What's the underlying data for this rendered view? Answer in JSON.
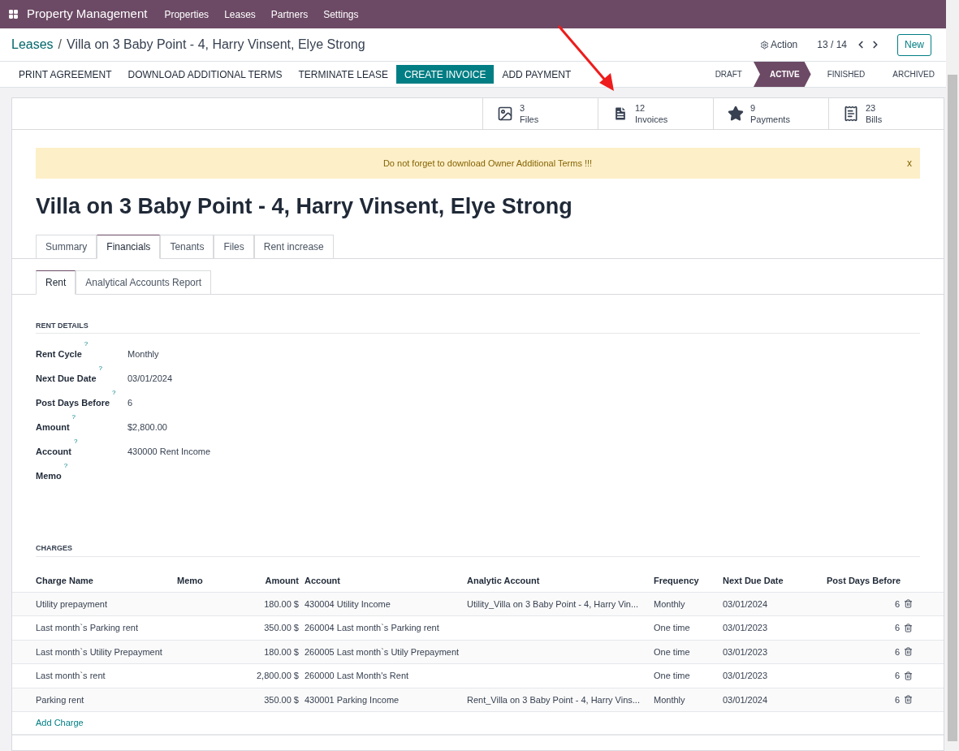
{
  "navbar": {
    "app_name": "Property Management",
    "menu": [
      "Properties",
      "Leases",
      "Partners",
      "Settings"
    ]
  },
  "breadcrumb": {
    "parent": "Leases",
    "separator": "/",
    "current": "Villa on 3 Baby Point - 4, Harry Vinsent, Elye Strong"
  },
  "control_panel": {
    "action": "Action",
    "pager": "13 / 14",
    "new_button": "New"
  },
  "action_buttons": [
    {
      "label": "PRINT AGREEMENT",
      "primary": false
    },
    {
      "label": "DOWNLOAD ADDITIONAL TERMS",
      "primary": false
    },
    {
      "label": "TERMINATE LEASE",
      "primary": false
    },
    {
      "label": "CREATE INVOICE",
      "primary": true
    },
    {
      "label": "ADD PAYMENT",
      "primary": false
    }
  ],
  "status_stages": [
    {
      "label": "DRAFT",
      "selected": false
    },
    {
      "label": "ACTIVE",
      "selected": true
    },
    {
      "label": "FINISHED",
      "selected": false
    },
    {
      "label": "ARCHIVED",
      "selected": false
    }
  ],
  "smart_buttons": [
    {
      "kind": "image",
      "count": "3",
      "label": "Files"
    },
    {
      "kind": "document",
      "count": "12",
      "label": "Invoices"
    },
    {
      "kind": "star",
      "count": "9",
      "label": "Payments"
    },
    {
      "kind": "bill",
      "count": "23",
      "label": "Bills"
    }
  ],
  "alert": {
    "message": "Do not forget to download Owner Additional Terms !!!",
    "close": "x"
  },
  "title": "Villa on 3 Baby Point - 4, Harry Vinsent, Elye Strong",
  "tabs": [
    {
      "label": "Summary",
      "selected": false
    },
    {
      "label": "Financials",
      "selected": true
    },
    {
      "label": "Tenants",
      "selected": false
    },
    {
      "label": "Files",
      "selected": false
    },
    {
      "label": "Rent increase",
      "selected": false
    }
  ],
  "subtabs": [
    {
      "label": "Rent",
      "selected": true
    },
    {
      "label": "Analytical Accounts Report",
      "selected": false
    }
  ],
  "rent_details": {
    "heading": "RENT DETAILS",
    "fields": [
      {
        "label": "Rent Cycle",
        "help": "?",
        "value": "Monthly"
      },
      {
        "label": "Next Due Date",
        "help": "?",
        "value": "03/01/2024"
      },
      {
        "label": "Post Days Before",
        "help": "?",
        "value": "6"
      },
      {
        "label": "Amount",
        "help": "?",
        "value": "$2,800.00"
      },
      {
        "label": "Account",
        "help": "?",
        "value": "430000 Rent Income"
      },
      {
        "label": "Memo",
        "help": "?"
      }
    ]
  },
  "charges": {
    "heading": "CHARGES",
    "columns": [
      "Charge Name",
      "Memo",
      "Amount",
      "Account",
      "Analytic Account",
      "Frequency",
      "Next Due Date",
      "Post Days Before"
    ],
    "rows": [
      [
        "Utility prepayment",
        "",
        "180.00 $",
        "430004 Utility Income",
        "Utility_Villa on 3 Baby Point - 4, Harry Vin...",
        "Monthly",
        "03/01/2024",
        "6"
      ],
      [
        "Last month`s Parking rent",
        "",
        "350.00 $",
        "260004 Last month`s Parking rent",
        "",
        "One time",
        "03/01/2023",
        "6"
      ],
      [
        "Last month`s Utility Prepayment",
        "",
        "180.00 $",
        "260005 Last month`s Utily Prepayment",
        "",
        "One time",
        "03/01/2023",
        "6"
      ],
      [
        "Last month`s rent",
        "",
        "2,800.00 $",
        "260000 Last Month's Rent",
        "",
        "One time",
        "03/01/2023",
        "6"
      ],
      [
        "Parking rent",
        "",
        "350.00 $",
        "430001 Parking Income",
        "Rent_Villa on 3 Baby Point - 4, Harry Vins...",
        "Monthly",
        "03/01/2024",
        "6"
      ]
    ],
    "add_link": "Add Charge"
  }
}
